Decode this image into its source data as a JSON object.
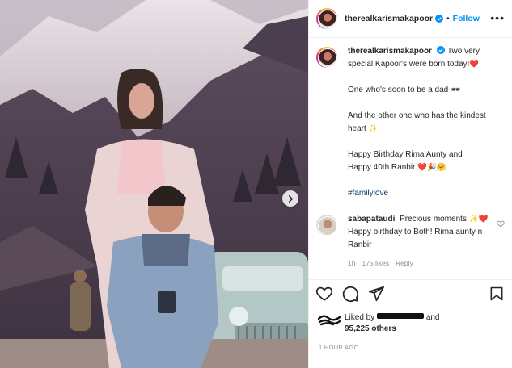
{
  "post": {
    "author": "therealkarismakapoor",
    "follow_label": "Follow",
    "separator": "•",
    "more_label": "•••",
    "caption": {
      "username": "therealkarismakapoor",
      "line1": "Two very special Kapoor's were born today!",
      "line1_emoji": "❤️",
      "line2": "One who's soon to be a dad",
      "line2_emoji": "🕶",
      "line3": "And the other one who has the kindest heart",
      "line3_emoji": "✨",
      "line4a": "Happy Birthday Rima Aunty and",
      "line4b": "Happy 40th Ranbir",
      "line4_emoji": "❤️🎉🤗",
      "hashtag": "#familylove"
    },
    "comment": {
      "username": "sabapataudi",
      "text_a": "Precious moments",
      "text_b": "Happy birthday to Both!",
      "text_c": "Rima aunty n Ranbir",
      "emoji_a": "✨❤️",
      "age": "1h",
      "likes": "175 likes",
      "reply": "Reply"
    },
    "likes": {
      "prefix": "Liked by",
      "suffix": "and",
      "count_line": "95,225 others"
    },
    "time": "1 HOUR AGO"
  },
  "colors": {
    "accent": "#0095f6",
    "heart": "#ed4956",
    "text": "#262626",
    "muted": "#8e8e8e"
  },
  "icons": {
    "like": "heart-outline-icon",
    "comment": "comment-icon",
    "share": "paper-plane-icon",
    "save": "bookmark-icon",
    "next": "chevron-right-icon"
  }
}
